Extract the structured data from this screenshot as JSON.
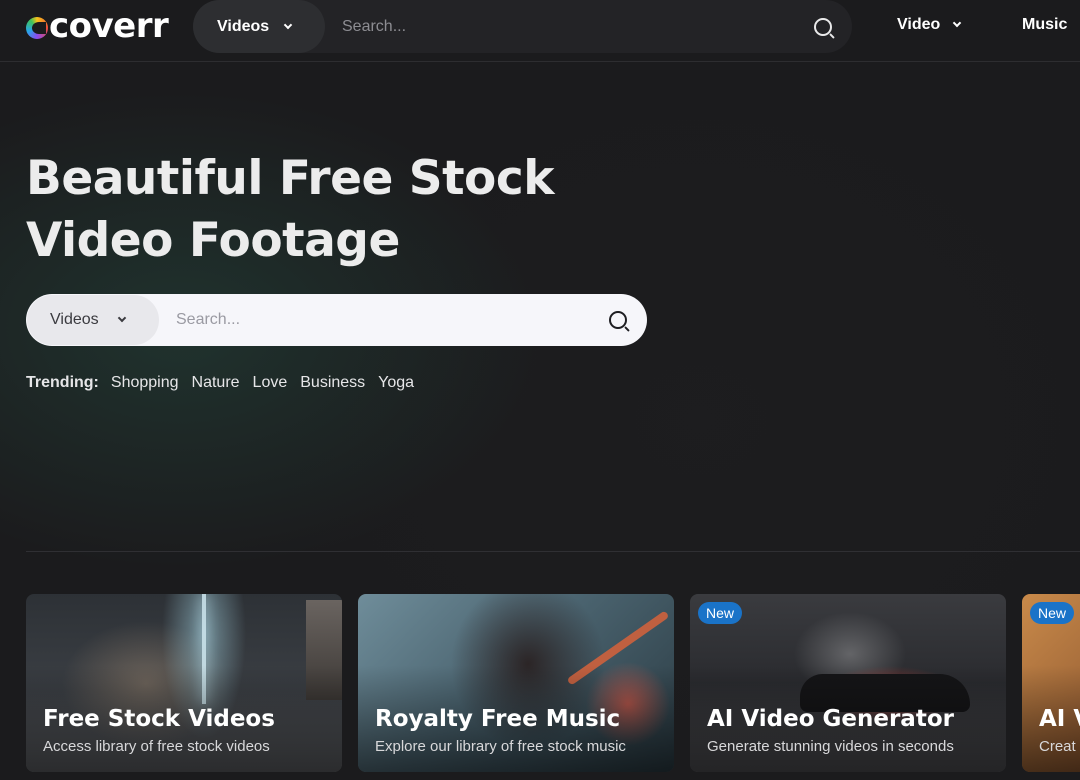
{
  "header": {
    "logo_text": "coverr",
    "search": {
      "type_label": "Videos",
      "placeholder": "Search..."
    },
    "nav": [
      {
        "label": "Video"
      },
      {
        "label": "Music"
      }
    ]
  },
  "hero": {
    "title_line1": "Beautiful Free Stock",
    "title_line2": "Video Footage",
    "search": {
      "type_label": "Videos",
      "placeholder": "Search..."
    },
    "trending_label": "Trending:",
    "trending": [
      "Shopping",
      "Nature",
      "Love",
      "Business",
      "Yoga"
    ]
  },
  "cards": [
    {
      "title": "Free Stock Videos",
      "subtitle": "Access library of free stock videos",
      "badge": ""
    },
    {
      "title": "Royalty Free Music",
      "subtitle": "Explore our library of free stock music",
      "badge": ""
    },
    {
      "title": "AI Video Generator",
      "subtitle": "Generate stunning videos in seconds",
      "badge": "New"
    },
    {
      "title": "AI V",
      "subtitle": "Creat",
      "badge": "New"
    }
  ],
  "colors": {
    "background": "#1b1b1d",
    "badge": "#1a73c8",
    "search_light": "#f6f6fa"
  }
}
